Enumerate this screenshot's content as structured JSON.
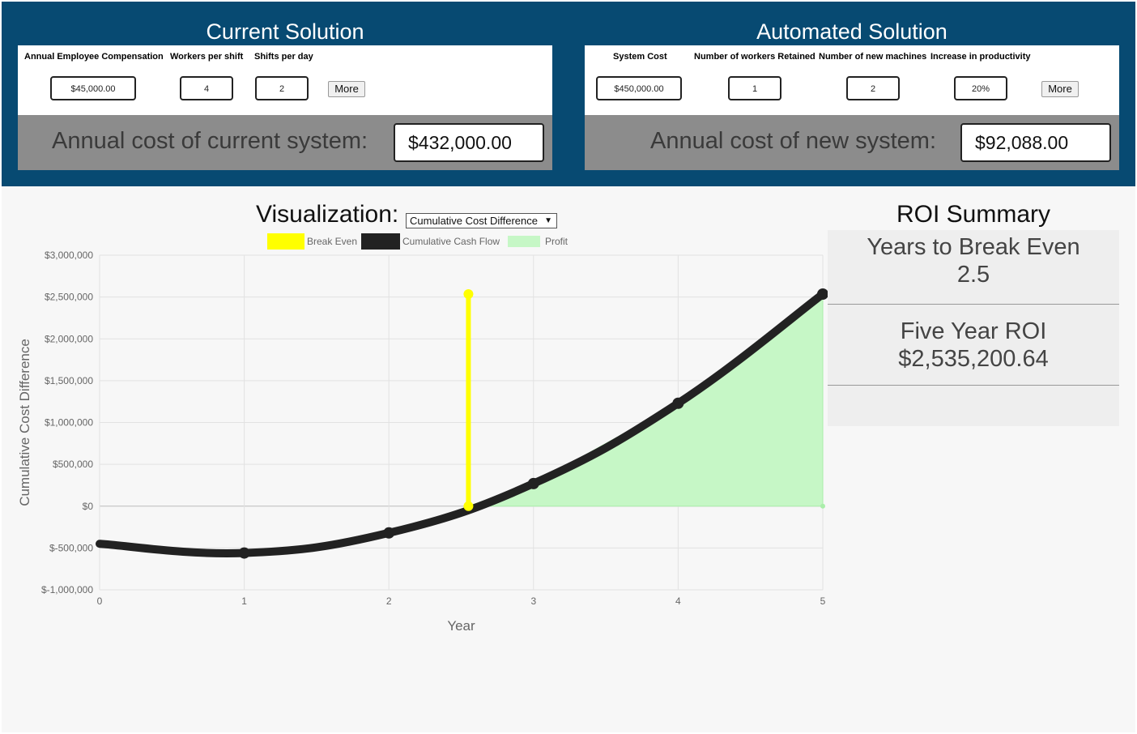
{
  "current": {
    "title": "Current Solution",
    "fields": [
      {
        "label": "Annual Employee Compensation",
        "value": "$45,000.00"
      },
      {
        "label": "Workers per shift",
        "value": "4"
      },
      {
        "label": "Shifts per day",
        "value": "2"
      }
    ],
    "more_label": "More",
    "cost_label": "Annual cost of current system:",
    "cost_value": "$432,000.00"
  },
  "automated": {
    "title": "Automated Solution",
    "fields": [
      {
        "label": "System Cost",
        "value": "$450,000.00"
      },
      {
        "label": "Number of workers Retained",
        "value": "1"
      },
      {
        "label": "Number of new machines",
        "value": "2"
      },
      {
        "label": "Increase in productivity",
        "value": "20%"
      }
    ],
    "more_label": "More",
    "cost_label": "Annual cost of new system:",
    "cost_value": "$92,088.00"
  },
  "visualization": {
    "title": "Visualization:",
    "selected": "Cumulative Cost Difference",
    "caret_icon": "caret-down-icon"
  },
  "legend": [
    {
      "label": "Break Even",
      "color": "#ffff00"
    },
    {
      "label": "Cumulative Cash Flow",
      "color": "#222222"
    },
    {
      "label": "Profit",
      "color": "#c6f7c6"
    }
  ],
  "roi": {
    "title": "ROI Summary",
    "break_even_label": "Years to Break Even",
    "break_even_value": "2.5",
    "five_year_label": "Five Year ROI",
    "five_year_value": "$2,535,200.64"
  },
  "chart_data": {
    "type": "line",
    "title": "",
    "xlabel": "Year",
    "ylabel": "Cumulative Cost Difference",
    "xlim": [
      0,
      5
    ],
    "ylim": [
      -1000000,
      3000000
    ],
    "x_ticks": [
      "0",
      "1",
      "2",
      "3",
      "4",
      "5"
    ],
    "y_ticks": [
      "$3,000,000",
      "$2,500,000",
      "$2,000,000",
      "$1,500,000",
      "$1,000,000",
      "$500,000",
      "$0",
      "$-500,000",
      "$-1,000,000"
    ],
    "grid": true,
    "legend_position": "top",
    "series": [
      {
        "name": "Cumulative Cash Flow",
        "color": "#222222",
        "x": [
          0,
          1,
          2,
          3,
          4,
          5
        ],
        "values": [
          -450000,
          -560000,
          -320000,
          270000,
          1230000,
          2535200
        ]
      },
      {
        "name": "Break Even",
        "color": "#ffff00",
        "x": [
          2.55,
          2.55
        ],
        "values": [
          0,
          2535200
        ]
      },
      {
        "name": "Profit",
        "color": "#c6f7c6",
        "x": [
          2.55,
          3,
          4,
          5
        ],
        "values": [
          0,
          270000,
          1230000,
          2535200
        ]
      }
    ]
  }
}
